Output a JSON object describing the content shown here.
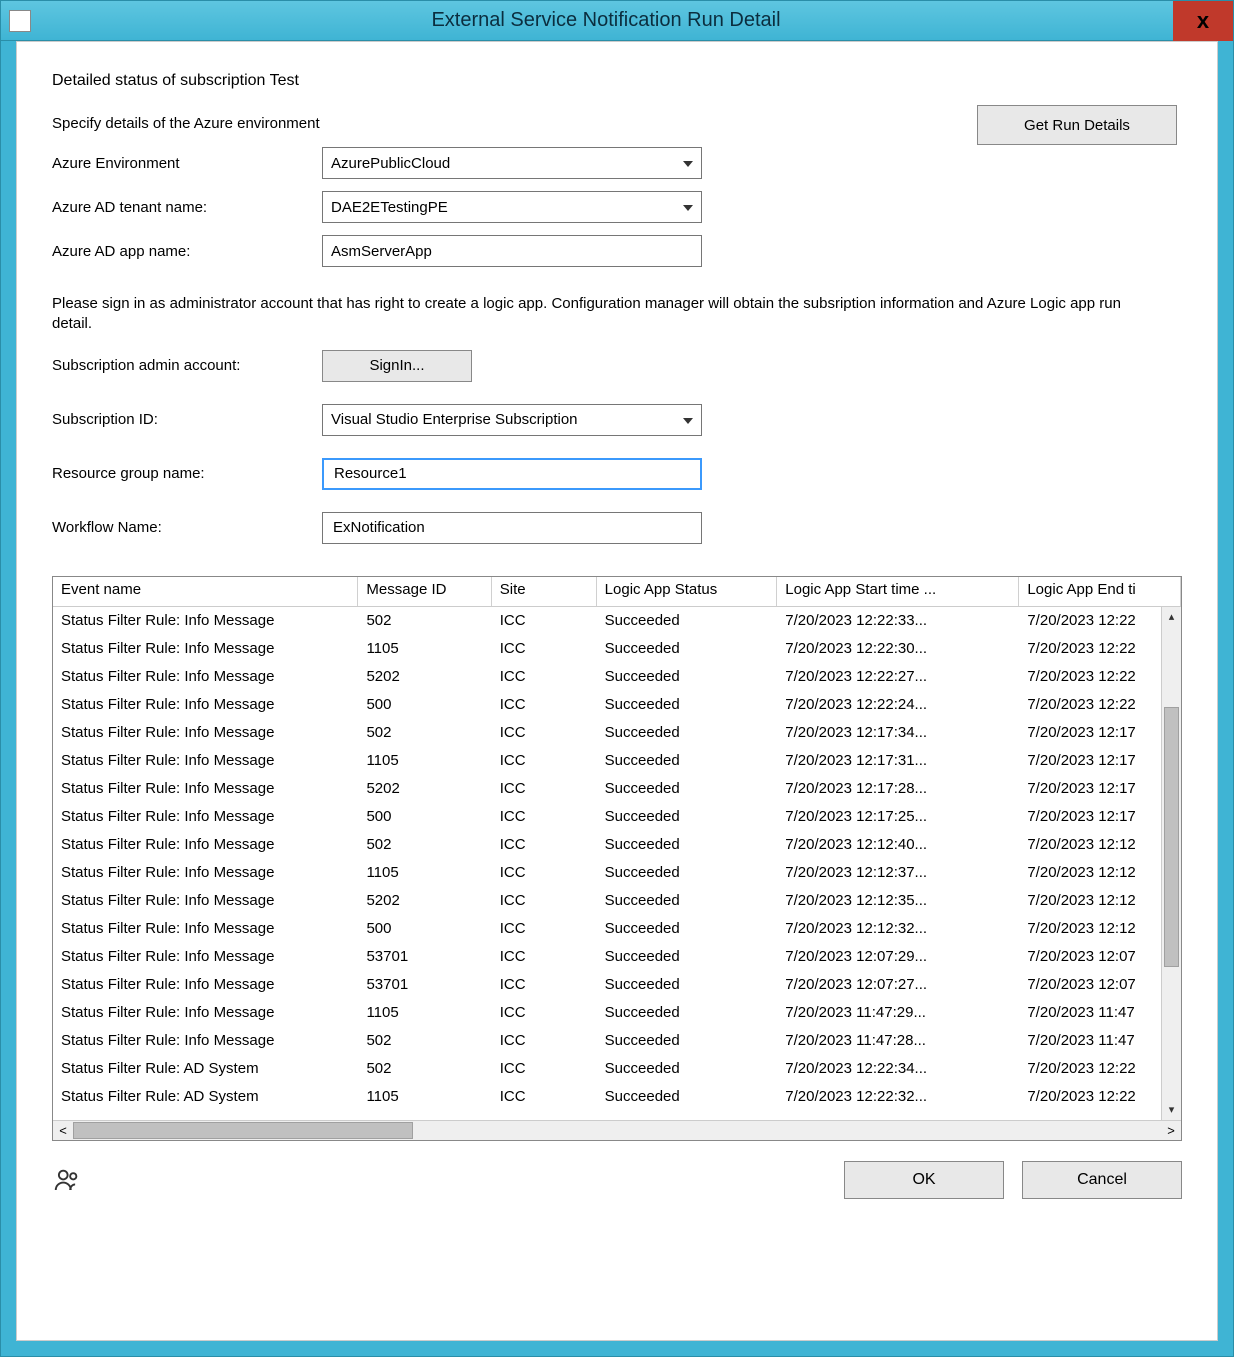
{
  "window": {
    "title": "External Service Notification Run Detail",
    "close_symbol": "x"
  },
  "header": {
    "subheading": "Detailed status of subscription Test",
    "specify": "Specify details of the Azure environment",
    "get_run_details": "Get Run Details",
    "para": "Please sign in as administrator account that has right to create a logic app. Configuration manager will obtain the subsription information and Azure Logic app run detail."
  },
  "form": {
    "azure_env_label": "Azure Environment",
    "azure_env_value": "AzurePublicCloud",
    "tenant_label": "Azure AD tenant name:",
    "tenant_value": "DAE2ETestingPE",
    "app_label": "Azure AD app name:",
    "app_value": "AsmServerApp",
    "sub_admin_label": "Subscription admin account:",
    "signin_label": "SignIn...",
    "sub_id_label": "Subscription ID:",
    "sub_id_value": "Visual Studio Enterprise Subscription",
    "resource_label": "Resource group name:",
    "resource_value": "Resource1",
    "workflow_label": "Workflow Name:",
    "workflow_value": "ExNotification"
  },
  "table": {
    "columns": [
      "Event name",
      "Message ID",
      "Site",
      "Logic App Status",
      "Logic App Start time ...",
      "Logic App End ti"
    ],
    "rows": [
      {
        "event": "Status Filter Rule: Info Message",
        "msg": "502",
        "site": "ICC",
        "status": "Succeeded",
        "start": "7/20/2023 12:22:33...",
        "end": "7/20/2023 12:22"
      },
      {
        "event": "Status Filter Rule: Info Message",
        "msg": "1105",
        "site": "ICC",
        "status": "Succeeded",
        "start": "7/20/2023 12:22:30...",
        "end": "7/20/2023 12:22"
      },
      {
        "event": "Status Filter Rule: Info Message",
        "msg": "5202",
        "site": "ICC",
        "status": "Succeeded",
        "start": "7/20/2023 12:22:27...",
        "end": "7/20/2023 12:22"
      },
      {
        "event": "Status Filter Rule: Info Message",
        "msg": "500",
        "site": "ICC",
        "status": "Succeeded",
        "start": "7/20/2023 12:22:24...",
        "end": "7/20/2023 12:22"
      },
      {
        "event": "Status Filter Rule: Info Message",
        "msg": "502",
        "site": "ICC",
        "status": "Succeeded",
        "start": "7/20/2023 12:17:34...",
        "end": "7/20/2023 12:17"
      },
      {
        "event": "Status Filter Rule: Info Message",
        "msg": "1105",
        "site": "ICC",
        "status": "Succeeded",
        "start": "7/20/2023 12:17:31...",
        "end": "7/20/2023 12:17"
      },
      {
        "event": "Status Filter Rule: Info Message",
        "msg": "5202",
        "site": "ICC",
        "status": "Succeeded",
        "start": "7/20/2023 12:17:28...",
        "end": "7/20/2023 12:17"
      },
      {
        "event": "Status Filter Rule: Info Message",
        "msg": "500",
        "site": "ICC",
        "status": "Succeeded",
        "start": "7/20/2023 12:17:25...",
        "end": "7/20/2023 12:17"
      },
      {
        "event": "Status Filter Rule: Info Message",
        "msg": "502",
        "site": "ICC",
        "status": "Succeeded",
        "start": "7/20/2023 12:12:40...",
        "end": "7/20/2023 12:12"
      },
      {
        "event": "Status Filter Rule: Info Message",
        "msg": "1105",
        "site": "ICC",
        "status": "Succeeded",
        "start": "7/20/2023 12:12:37...",
        "end": "7/20/2023 12:12"
      },
      {
        "event": "Status Filter Rule: Info Message",
        "msg": "5202",
        "site": "ICC",
        "status": "Succeeded",
        "start": "7/20/2023 12:12:35...",
        "end": "7/20/2023 12:12"
      },
      {
        "event": "Status Filter Rule: Info Message",
        "msg": "500",
        "site": "ICC",
        "status": "Succeeded",
        "start": "7/20/2023 12:12:32...",
        "end": "7/20/2023 12:12"
      },
      {
        "event": "Status Filter Rule: Info Message",
        "msg": "53701",
        "site": "ICC",
        "status": "Succeeded",
        "start": "7/20/2023 12:07:29...",
        "end": "7/20/2023 12:07"
      },
      {
        "event": "Status Filter Rule: Info Message",
        "msg": "53701",
        "site": "ICC",
        "status": "Succeeded",
        "start": "7/20/2023 12:07:27...",
        "end": "7/20/2023 12:07"
      },
      {
        "event": "Status Filter Rule: Info Message",
        "msg": "1105",
        "site": "ICC",
        "status": "Succeeded",
        "start": "7/20/2023 11:47:29...",
        "end": "7/20/2023 11:47"
      },
      {
        "event": "Status Filter Rule: Info Message",
        "msg": "502",
        "site": "ICC",
        "status": "Succeeded",
        "start": "7/20/2023 11:47:28...",
        "end": "7/20/2023 11:47"
      },
      {
        "event": "Status Filter Rule: AD System",
        "msg": "502",
        "site": "ICC",
        "status": "Succeeded",
        "start": "7/20/2023 12:22:34...",
        "end": "7/20/2023 12:22"
      },
      {
        "event": "Status Filter Rule: AD System",
        "msg": "1105",
        "site": "ICC",
        "status": "Succeeded",
        "start": "7/20/2023 12:22:32...",
        "end": "7/20/2023 12:22"
      }
    ]
  },
  "footer": {
    "ok": "OK",
    "cancel": "Cancel"
  }
}
